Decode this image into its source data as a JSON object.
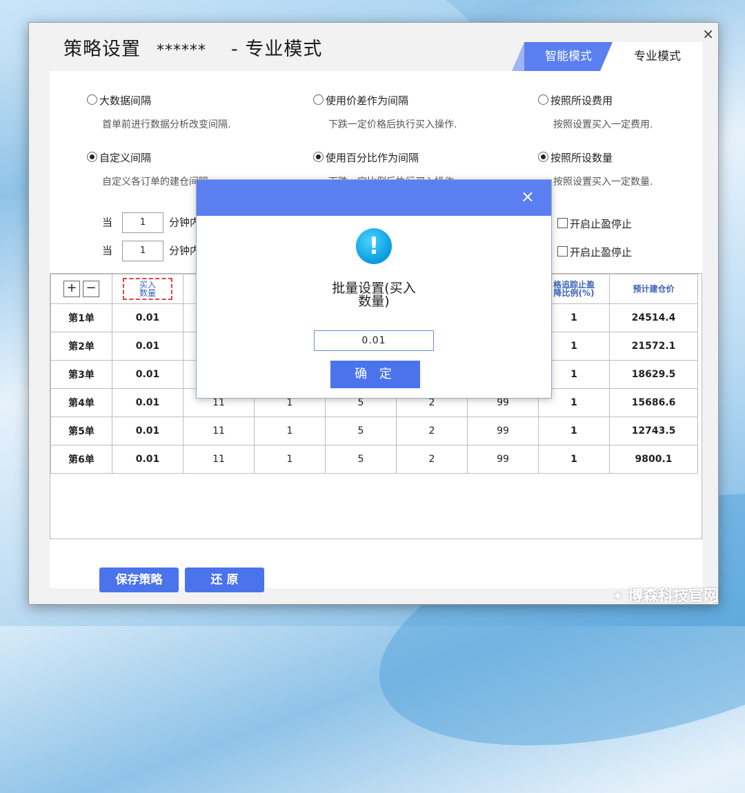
{
  "window": {
    "title_name": "策略设置",
    "title_stars": "******",
    "title_mode": "- 专业模式",
    "close_glyph": "×",
    "tabs": [
      {
        "label": "智能模式",
        "active": true
      },
      {
        "label": "专业模式",
        "active": false
      }
    ]
  },
  "options": {
    "row1": [
      {
        "label": "大数据间隔",
        "desc": "首单前进行数据分析改变间隔.",
        "selected": false
      },
      {
        "label": "使用价差作为间隔",
        "desc": "下跌一定价格后执行买入操作.",
        "selected": false
      },
      {
        "label": "按照所设费用",
        "desc": "按照设置买入一定费用.",
        "selected": false
      }
    ],
    "row2": [
      {
        "label": "自定义间隔",
        "desc": "自定义各订单的建仓间隔.",
        "selected": true
      },
      {
        "label": "使用百分比作为间隔",
        "desc": "下跌一定比例后执行买入操作.",
        "selected": true
      },
      {
        "label": "按照所设数量",
        "desc": "按照设置买入一定数量.",
        "selected": true
      }
    ]
  },
  "conditions": [
    {
      "prefix": "当",
      "value": "1",
      "suffix": "分钟内",
      "check_label": "开启止盈停止"
    },
    {
      "prefix": "当",
      "value": "1",
      "suffix": "分钟内",
      "check_label": "开启止盈停止"
    }
  ],
  "table": {
    "add_label": "+",
    "remove_label": "−",
    "highlight_header": "买入\n数量",
    "col7_header": "格追踪止盈\n降比例(%)",
    "col8_header": "预计建仓价",
    "rows": [
      {
        "name": "第1单",
        "qty": "0.01",
        "c2": "",
        "c3": "",
        "c4": "",
        "c5": "",
        "c6": "",
        "c7": "1",
        "price": "24514.4"
      },
      {
        "name": "第2单",
        "qty": "0.01",
        "c2": "",
        "c3": "",
        "c4": "",
        "c5": "",
        "c6": "",
        "c7": "1",
        "price": "21572.1"
      },
      {
        "name": "第3单",
        "qty": "0.01",
        "c2": "",
        "c3": "",
        "c4": "",
        "c5": "",
        "c6": "",
        "c7": "1",
        "price": "18629.5"
      },
      {
        "name": "第4单",
        "qty": "0.01",
        "c2": "11",
        "c3": "1",
        "c4": "5",
        "c5": "2",
        "c6": "99",
        "c7": "1",
        "price": "15686.6"
      },
      {
        "name": "第5单",
        "qty": "0.01",
        "c2": "11",
        "c3": "1",
        "c4": "5",
        "c5": "2",
        "c6": "99",
        "c7": "1",
        "price": "12743.5"
      },
      {
        "name": "第6单",
        "qty": "0.01",
        "c2": "11",
        "c3": "1",
        "c4": "5",
        "c5": "2",
        "c6": "99",
        "c7": "1",
        "price": "9800.1"
      }
    ]
  },
  "buttons": {
    "save": "保存策略",
    "restore": "还 原"
  },
  "dialog": {
    "close_glyph": "×",
    "icon_glyph": "!",
    "text_line1": "批量设置(买入",
    "text_line2": "数量)",
    "input_value": "0.01",
    "ok_label": "确 定"
  },
  "watermark": {
    "text": "博森科技官网",
    "icon_glyph": "✦"
  },
  "colors": {
    "accent": "#5b7ff0",
    "button": "#4a73ec",
    "header_text": "#3b62b5",
    "highlight_border": "#e04040"
  }
}
